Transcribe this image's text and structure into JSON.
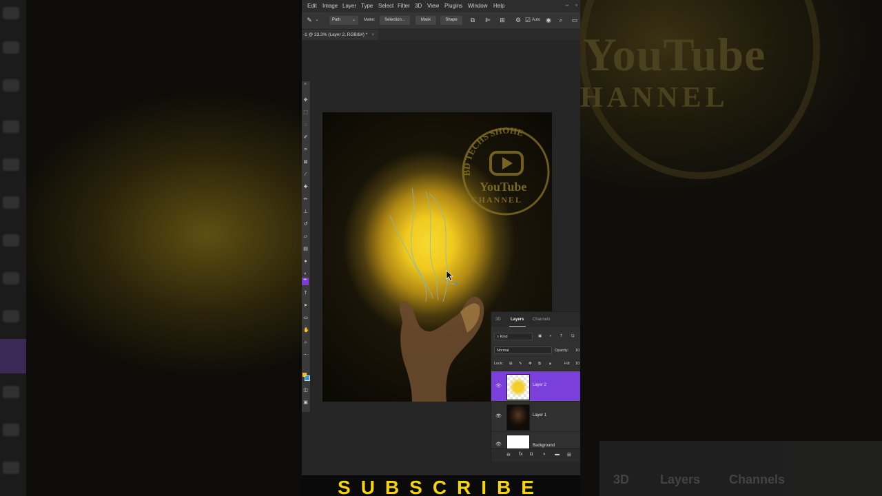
{
  "menu": [
    "Edit",
    "Image",
    "Layer",
    "Type",
    "Select",
    "Filter",
    "3D",
    "View",
    "Plugins",
    "Window",
    "Help"
  ],
  "options_bar": {
    "tool_mode": "Path",
    "make_label": "Make:",
    "selection_button": "Selection...",
    "mask_button": "Mask",
    "shape_button": "Shape",
    "auto_label": "Auto"
  },
  "document_tab": {
    "title": "-1 @ 33.3% (Layer 2, RGB/8#) *",
    "close": "×"
  },
  "watermark": {
    "ring_text": "BD TECHS SHOHE",
    "brand": "YouTube",
    "sub": "CHANNEL"
  },
  "layers_panel": {
    "tabs": [
      "3D",
      "Layers",
      "Channels"
    ],
    "filter_kind": "Kind",
    "blend_mode": "Normal",
    "opacity_label": "Opacity:",
    "opacity_value": "10",
    "lock_label": "Lock:",
    "fill_label": "Fill:",
    "fill_value": "10",
    "layers": [
      {
        "name": "Layer 2",
        "selected": true
      },
      {
        "name": "Layer 1",
        "selected": false
      },
      {
        "name": "Background",
        "selected": false
      }
    ]
  },
  "subscribe_text": "SUBSCRIBE",
  "background_blur": {
    "yt": "YouTube",
    "ch": "HANNEL",
    "tabs": [
      "3D",
      "Layers",
      "Channels"
    ]
  },
  "colors": {
    "accent_selection": "#7b3fdc",
    "subscribe_yellow": "#f5d40a",
    "foreground_swatch": "#f2c200",
    "background_swatch": "#2aa0d8"
  }
}
